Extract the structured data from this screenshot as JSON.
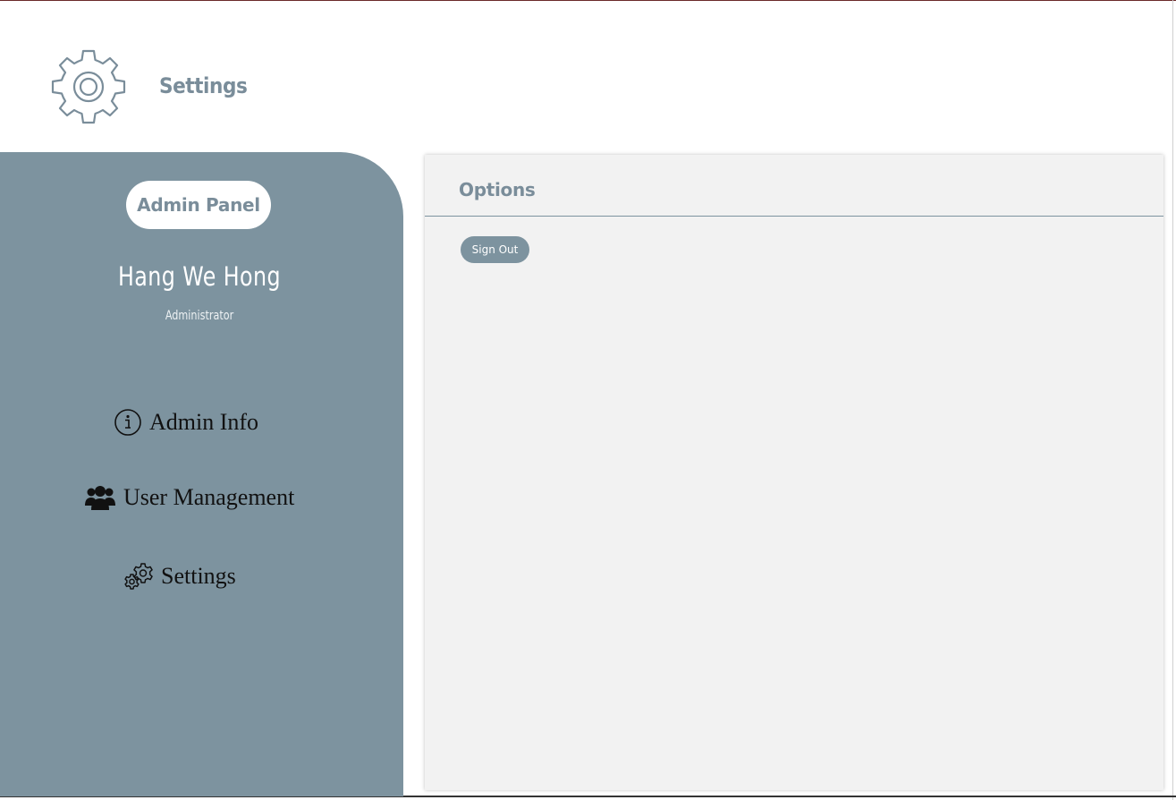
{
  "header": {
    "title": "Settings",
    "icon": "gear-icon"
  },
  "sidebar": {
    "panel_label": "Admin Panel",
    "user_name": "Hang We Hong",
    "user_role": "Administrator",
    "items": [
      {
        "label": "Admin Info",
        "icon": "info-circle-icon"
      },
      {
        "label": "User Management",
        "icon": "users-icon"
      },
      {
        "label": "Settings",
        "icon": "gears-icon"
      }
    ]
  },
  "main": {
    "title": "Options",
    "signout_label": "Sign Out"
  },
  "colors": {
    "accent": "#7d939f",
    "accent_text": "#7a8d9a",
    "panel_bg": "#f2f2f2"
  }
}
